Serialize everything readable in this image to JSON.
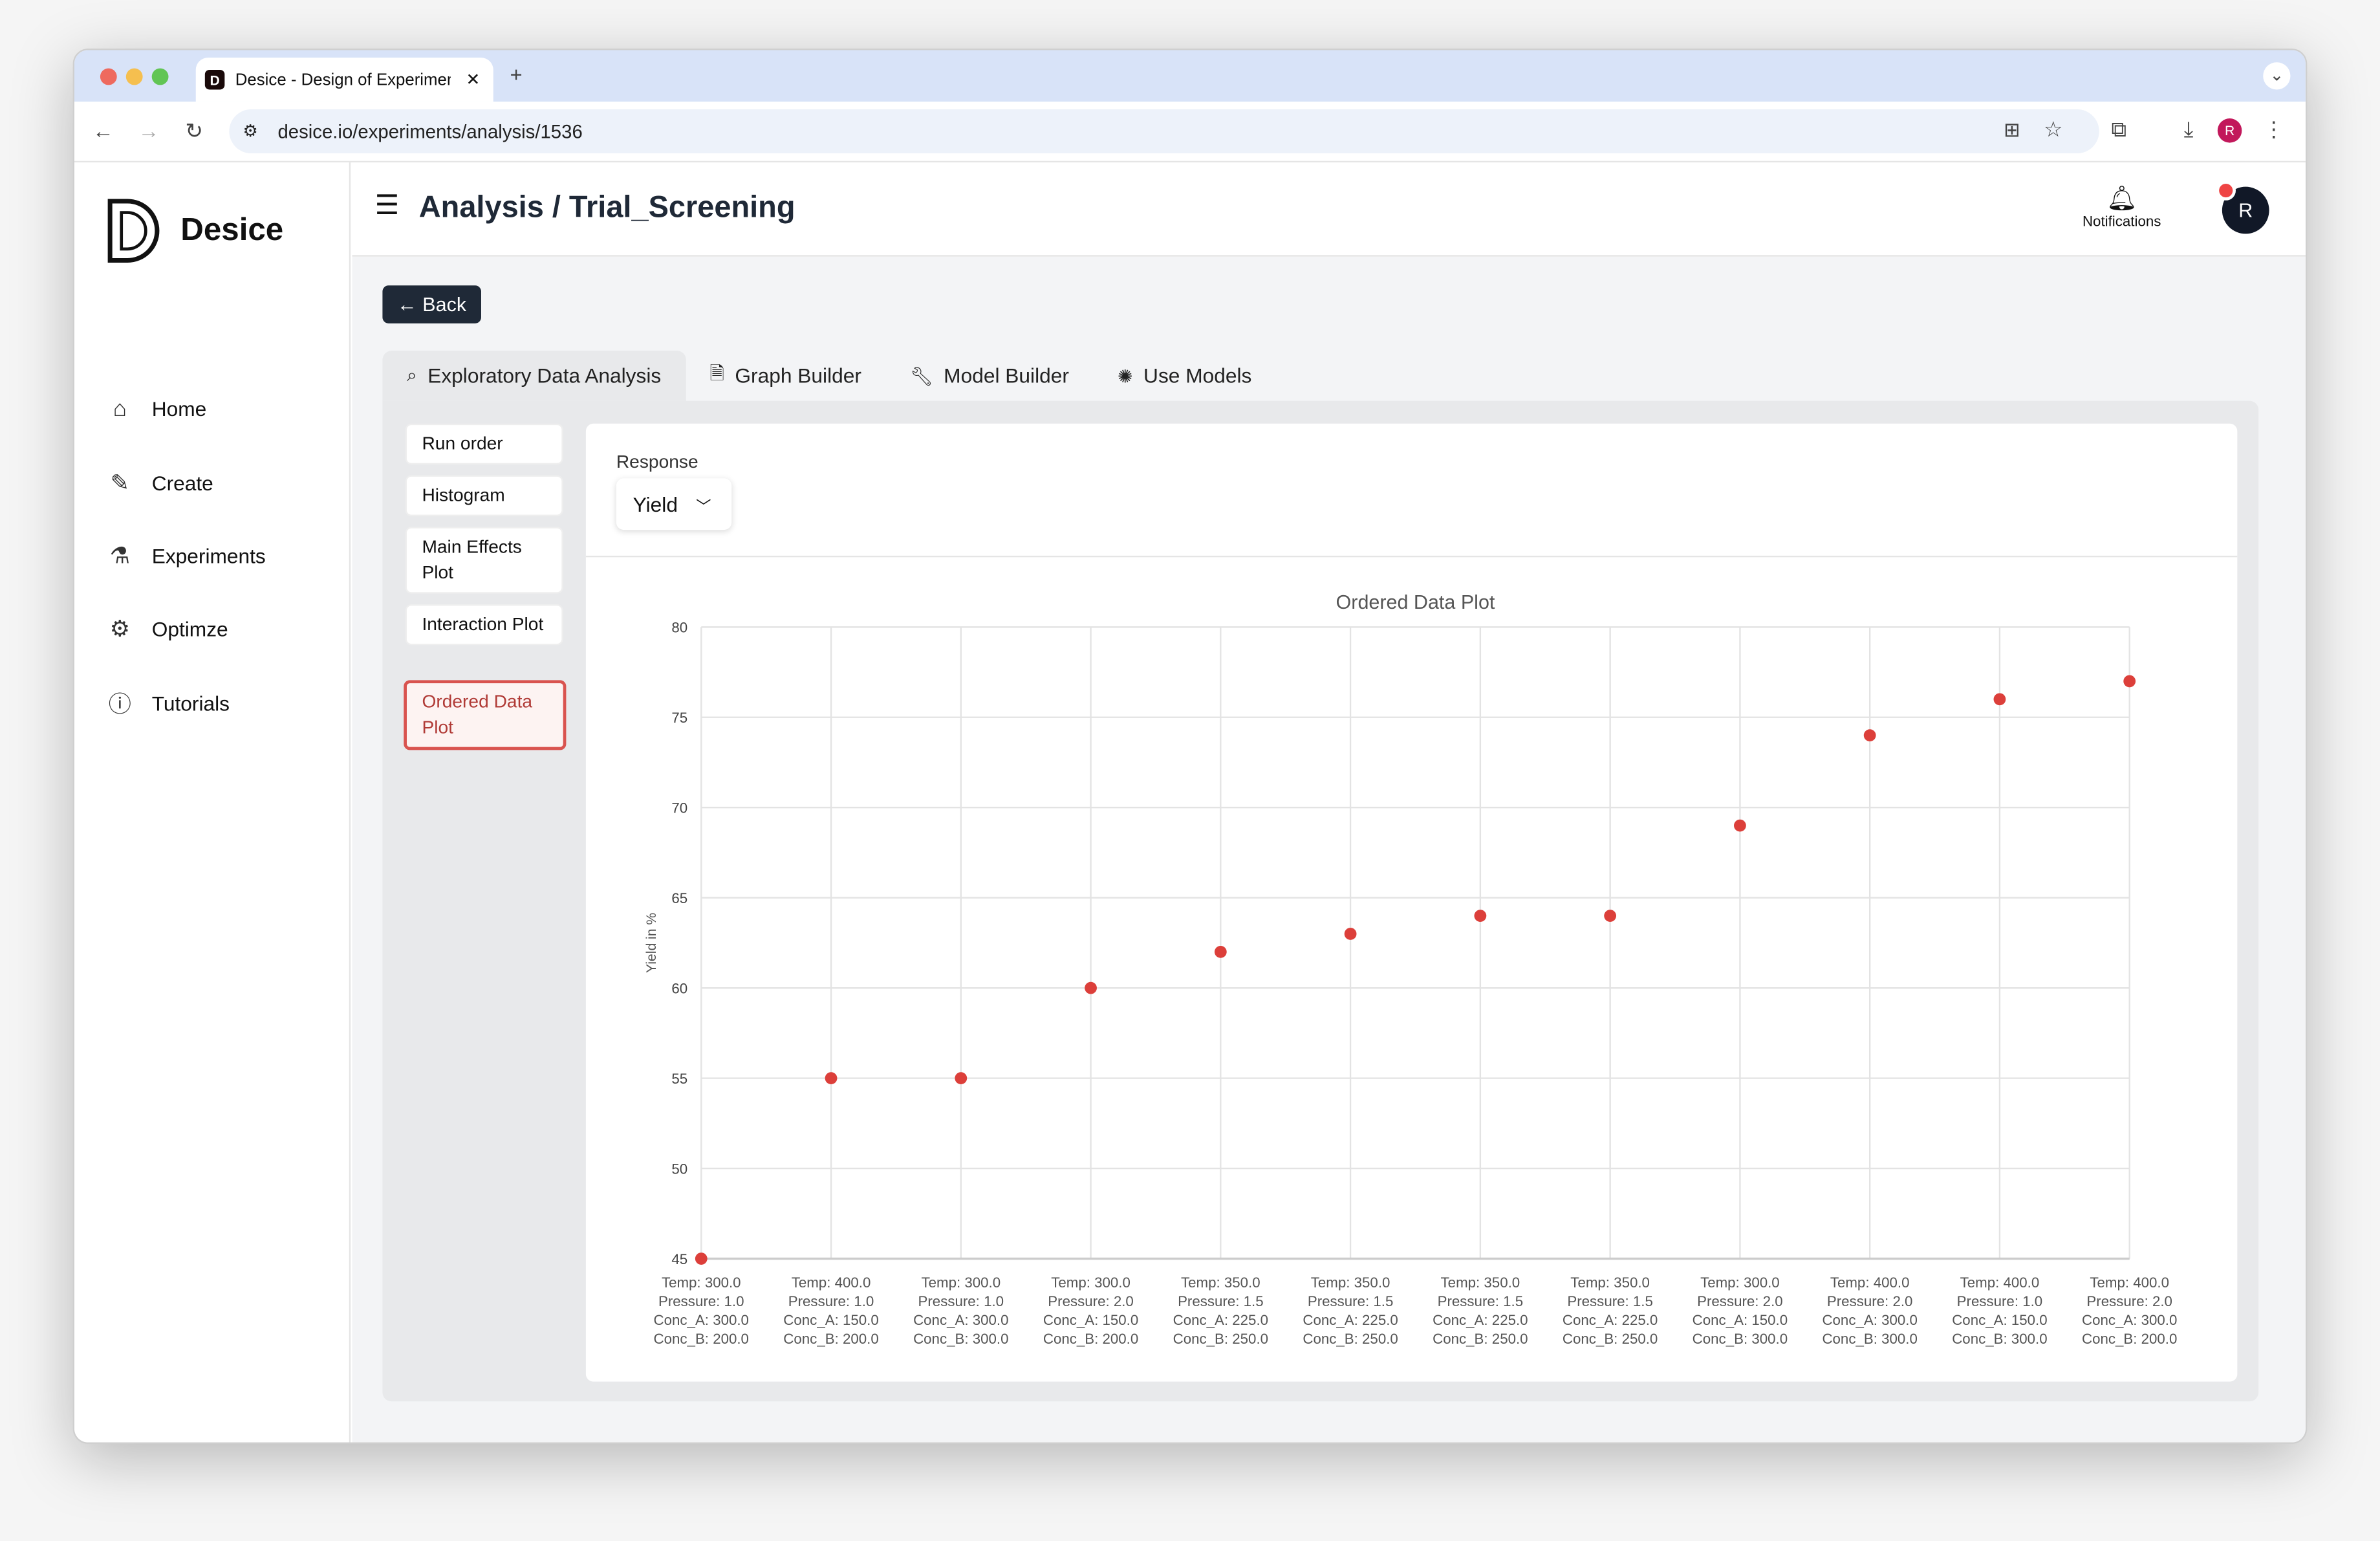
{
  "browser": {
    "tab_title": "Desice - Design of Experimen",
    "favicon": "D",
    "url": "desice.io/experiments/analysis/1536",
    "profile": "R"
  },
  "sidebar": {
    "brand": "Desice",
    "items": [
      {
        "label": "Home",
        "icon": "home-icon"
      },
      {
        "label": "Create",
        "icon": "pencil-icon"
      },
      {
        "label": "Experiments",
        "icon": "flask-icon"
      },
      {
        "label": "Optimze",
        "icon": "gear-icon"
      },
      {
        "label": "Tutorials",
        "icon": "info-icon"
      }
    ]
  },
  "header": {
    "title": "Analysis / Trial_Screening",
    "notifications": "Notifications",
    "avatar": "R"
  },
  "back_label": "← Back",
  "tabs": [
    {
      "label": "Exploratory Data Analysis",
      "icon": "search-icon"
    },
    {
      "label": "Graph Builder",
      "icon": "document-icon"
    },
    {
      "label": "Model Builder",
      "icon": "wrench-icon"
    },
    {
      "label": "Use Models",
      "icon": "sparkle-icon"
    }
  ],
  "plot_menu": [
    "Run order",
    "Histogram",
    "Main Effects Plot",
    "Interaction Plot",
    "Ordered Data Plot"
  ],
  "response": {
    "label": "Response",
    "value": "Yield"
  },
  "accent": "#dc3f3a",
  "chart_data": {
    "type": "scatter",
    "title": "Ordered Data Plot",
    "ylabel": "Yield in %",
    "xlabel": "",
    "ylim": [
      45,
      80
    ],
    "yticks": [
      45,
      50,
      55,
      60,
      65,
      70,
      75,
      80
    ],
    "grid": true,
    "categories": [
      [
        "Temp: 300.0",
        "Pressure: 1.0",
        "Conc_A: 300.0",
        "Conc_B: 200.0"
      ],
      [
        "Temp: 400.0",
        "Pressure: 1.0",
        "Conc_A: 150.0",
        "Conc_B: 200.0"
      ],
      [
        "Temp: 300.0",
        "Pressure: 1.0",
        "Conc_A: 300.0",
        "Conc_B: 300.0"
      ],
      [
        "Temp: 300.0",
        "Pressure: 2.0",
        "Conc_A: 150.0",
        "Conc_B: 200.0"
      ],
      [
        "Temp: 350.0",
        "Pressure: 1.5",
        "Conc_A: 225.0",
        "Conc_B: 250.0"
      ],
      [
        "Temp: 350.0",
        "Pressure: 1.5",
        "Conc_A: 225.0",
        "Conc_B: 250.0"
      ],
      [
        "Temp: 350.0",
        "Pressure: 1.5",
        "Conc_A: 225.0",
        "Conc_B: 250.0"
      ],
      [
        "Temp: 350.0",
        "Pressure: 1.5",
        "Conc_A: 225.0",
        "Conc_B: 250.0"
      ],
      [
        "Temp: 300.0",
        "Pressure: 2.0",
        "Conc_A: 150.0",
        "Conc_B: 300.0"
      ],
      [
        "Temp: 400.0",
        "Pressure: 2.0",
        "Conc_A: 300.0",
        "Conc_B: 300.0"
      ],
      [
        "Temp: 400.0",
        "Pressure: 1.0",
        "Conc_A: 150.0",
        "Conc_B: 300.0"
      ],
      [
        "Temp: 400.0",
        "Pressure: 2.0",
        "Conc_A: 300.0",
        "Conc_B: 200.0"
      ]
    ],
    "values": [
      45,
      55,
      55,
      60,
      62,
      63,
      64,
      64,
      69,
      74,
      76,
      77
    ],
    "marker_color": "#dc3f3a"
  }
}
